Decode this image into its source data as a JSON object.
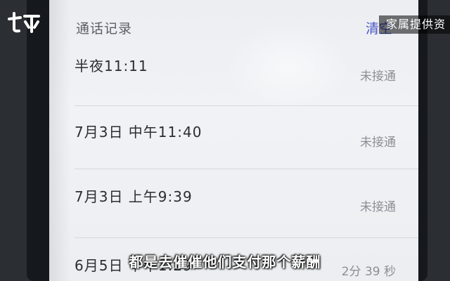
{
  "header": {
    "title": "通话记录",
    "clear_label": "清空"
  },
  "calls": [
    {
      "time": "半夜11:11",
      "status": "未接通"
    },
    {
      "time": "7月3日  中午11:40",
      "status": "未接通"
    },
    {
      "time": "7月3日  上午9:39",
      "status": "未接通"
    },
    {
      "time": "6月5日  下午1:29",
      "status": "2分 39 秒"
    }
  ],
  "overlay": {
    "logo_text": "七环",
    "source_tag": "家属提供资",
    "subtitle": "都是去催催他们支付那个薪酬"
  },
  "colors": {
    "accent": "#4a57c6",
    "logo": "#ffffff"
  }
}
